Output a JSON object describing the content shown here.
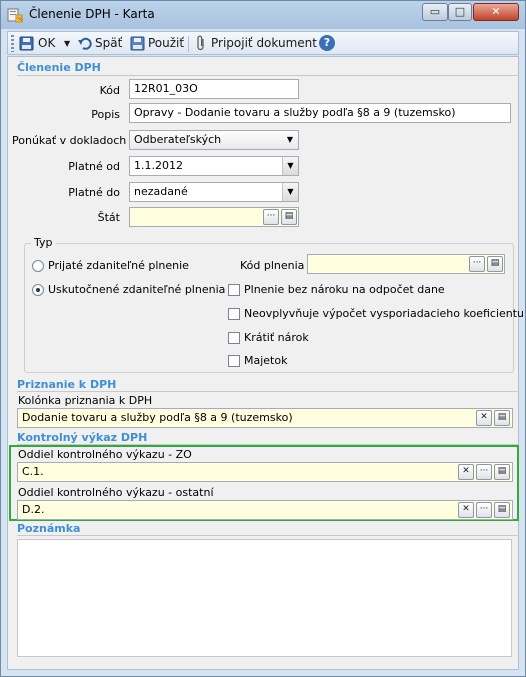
{
  "window": {
    "title": "Členenie DPH - Karta",
    "controls": {
      "minimize": "▭",
      "maximize": "□",
      "close": "✕"
    }
  },
  "toolbar": {
    "ok_label": "OK",
    "back_label": "Späť",
    "use_label": "Použiť",
    "attach_label": "Pripojiť dokument",
    "help_icon": "?"
  },
  "sections": {
    "clenenie": "Členenie DPH",
    "priznanie": "Priznanie k DPH",
    "kontrolny": "Kontrolný výkaz DPH",
    "poznamka": "Poznámka"
  },
  "form": {
    "kod_label": "Kód",
    "kod_value": "12R01_03O",
    "popis_label": "Popis",
    "popis_value": "Opravy - Dodanie tovaru a služby podľa §8 a 9 (tuzemsko)",
    "ponukat_label": "Ponúkať v dokladoch",
    "ponukat_value": "Odberateľských",
    "platne_od_label": "Platné od",
    "platne_od_value": "1.1.2012",
    "platne_do_label": "Platné do",
    "platne_do_value": "nezadané",
    "stat_label": "Štát",
    "stat_value": ""
  },
  "typ": {
    "title": "Typ",
    "radio_prijate": "Prijaté zdaniteľné plnenie",
    "radio_uskutocnene": "Uskutočnené zdaniteľné plnenia",
    "kod_plnenia_label": "Kód plnenia",
    "kod_plnenia_value": "",
    "cb_bez_naroku": "Plnenie bez nároku na odpočet dane",
    "cb_neovplyvnuje": "Neovplyvňuje výpočet vysporiadacieho koeficientu",
    "cb_kratit": "Krátiť nárok",
    "cb_majetok": "Majetok"
  },
  "priznanie": {
    "kolonka_label": "Kolónka priznania k DPH",
    "kolonka_value": "Dodanie tovaru a služby podľa §8 a 9 (tuzemsko)"
  },
  "kontrolny": {
    "zo_label": "Oddiel kontrolného výkazu - ZO",
    "zo_value": "C.1.",
    "ostatne_label": "Oddiel kontrolného výkazu - ostatní",
    "ostatne_value": "D.2."
  },
  "icons": {
    "ellipsis": "···",
    "clear": "✕",
    "list": "▤",
    "dropdown": "▼"
  }
}
